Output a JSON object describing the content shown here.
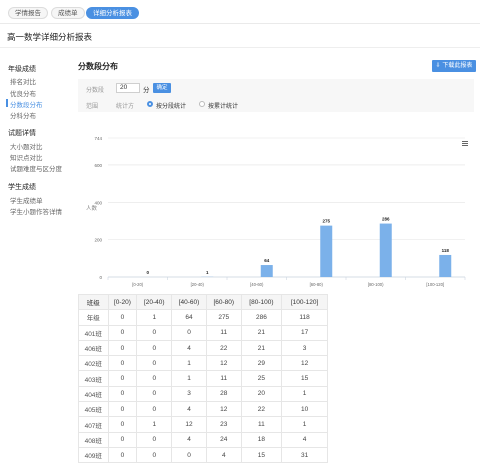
{
  "tabs": [
    {
      "label": "学情报告",
      "active": false
    },
    {
      "label": "成绩单",
      "active": false
    },
    {
      "label": "详细分析报表",
      "active": true
    }
  ],
  "page_title": "高一数学详细分析报表",
  "sidebar": {
    "groups": [
      {
        "title": "年级成绩",
        "items": [
          {
            "label": "排名对比",
            "active": false
          },
          {
            "label": "优良分布",
            "active": false
          },
          {
            "label": "分数段分布",
            "active": true
          },
          {
            "label": "分科分布",
            "active": false
          }
        ]
      },
      {
        "title": "试题详情",
        "items": [
          {
            "label": "大小题对比",
            "active": false
          },
          {
            "label": "知识点对比",
            "active": false
          },
          {
            "label": "试题难度与区分度",
            "active": false
          }
        ]
      },
      {
        "title": "学生成绩",
        "items": [
          {
            "label": "学生成绩单",
            "active": false
          },
          {
            "label": "学生小题作答详情",
            "active": false
          }
        ]
      }
    ]
  },
  "section": {
    "title": "分数段分布",
    "download_label": "下载此报表",
    "filter": {
      "score_label": "分数段",
      "score_value": "20",
      "unit": "分",
      "confirm_label": "确定",
      "range_label": "范围",
      "stat_label": "统计方",
      "options": [
        {
          "label": "按分段统计",
          "selected": true
        },
        {
          "label": "按累计统计",
          "selected": false
        }
      ]
    }
  },
  "chart_data": {
    "type": "bar",
    "title": "",
    "xlabel": "",
    "ylabel": "人数",
    "categories": [
      "[0-20)",
      "[20-40)",
      "[40-60)",
      "[60-80)",
      "[80-100)",
      "[100-120]"
    ],
    "values": [
      0,
      1,
      64,
      275,
      286,
      118
    ],
    "y_ticks": [
      0,
      200,
      400,
      600,
      744
    ],
    "ylim": [
      0,
      744
    ],
    "bar_color": "#7bb1ea",
    "grid": true
  },
  "table": {
    "headers": [
      "班级",
      "[0-20)",
      "[20-40)",
      "[40-60)",
      "[60-80)",
      "[80-100)",
      "[100-120]"
    ],
    "rows": [
      [
        "年级",
        "0",
        "1",
        "64",
        "275",
        "286",
        "118"
      ],
      [
        "401班",
        "0",
        "0",
        "0",
        "11",
        "21",
        "17"
      ],
      [
        "406班",
        "0",
        "0",
        "4",
        "22",
        "21",
        "3"
      ],
      [
        "402班",
        "0",
        "0",
        "1",
        "12",
        "29",
        "12"
      ],
      [
        "403班",
        "0",
        "0",
        "1",
        "11",
        "25",
        "15"
      ],
      [
        "404班",
        "0",
        "0",
        "3",
        "28",
        "20",
        "1"
      ],
      [
        "405班",
        "0",
        "0",
        "4",
        "12",
        "22",
        "10"
      ],
      [
        "407班",
        "0",
        "1",
        "12",
        "23",
        "11",
        "1"
      ],
      [
        "408班",
        "0",
        "0",
        "4",
        "24",
        "18",
        "4"
      ],
      [
        "409班",
        "0",
        "0",
        "0",
        "4",
        "15",
        "31"
      ]
    ]
  }
}
